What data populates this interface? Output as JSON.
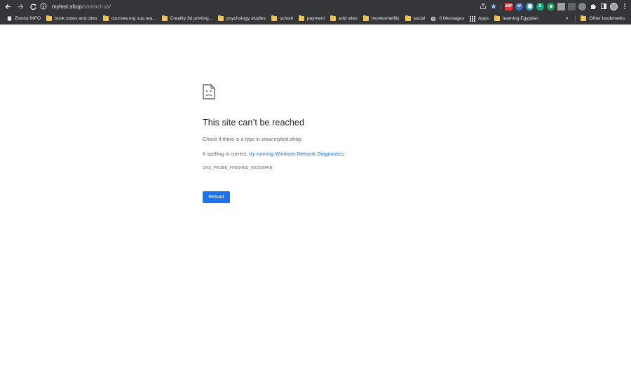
{
  "browser": {
    "url_host": "mylest.shop",
    "url_path": "/contact-us/",
    "bookmarks": [
      {
        "label": "Zionist INFO",
        "icon": "page-icon"
      },
      {
        "label": "book notes and cites",
        "icon": "folder-icon"
      },
      {
        "label": "coursea.org sup.rea...",
        "icon": "folder-icon"
      },
      {
        "label": "Creality 3d printing...",
        "icon": "folder-icon"
      },
      {
        "label": "psychology studies",
        "icon": "folder-icon"
      },
      {
        "label": "school",
        "icon": "folder-icon"
      },
      {
        "label": "payment",
        "icon": "folder-icon"
      },
      {
        "label": "edd sites",
        "icon": "folder-icon"
      },
      {
        "label": "movies/netflix",
        "icon": "folder-icon"
      },
      {
        "label": "social",
        "icon": "folder-icon"
      },
      {
        "label": "0 Messages",
        "icon": "globe-icon"
      },
      {
        "label": "Apps",
        "icon": "apps-grid-icon"
      },
      {
        "label": "learning Egyptian",
        "icon": "folder-icon"
      }
    ],
    "overflow_label": "»",
    "other_bookmarks": "Other bookmarks",
    "extensions": {
      "abp_label": "ABP"
    }
  },
  "error": {
    "title": "This site can’t be reached",
    "line1": "Check if there is a typo in www.mylest.shop.",
    "line2_prefix": "If spelling is correct, ",
    "line2_link": "try running Windows Network Diagnostics",
    "line2_suffix": ".",
    "code": "DNS_PROBE_FINISHED_NXDOMAIN",
    "reload_label": "Reload"
  },
  "colors": {
    "toolbar_bg": "#35363a",
    "accent": "#1a73e8",
    "title": "#202124",
    "body_text": "#5f6368"
  }
}
